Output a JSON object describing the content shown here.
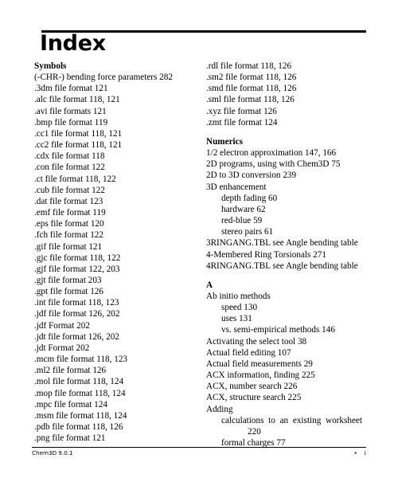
{
  "document": {
    "title": "Index"
  },
  "footer": {
    "left_text": "Chem3D 9.0.1",
    "bullet": "•",
    "page_number": "i"
  },
  "columns": {
    "left": [
      {
        "type": "section",
        "text": "Symbols"
      },
      {
        "type": "entry",
        "text": "(-CHR-) bending force parameters 282"
      },
      {
        "type": "entry",
        "text": ".3dm file format 121"
      },
      {
        "type": "entry",
        "text": ".alc file format 118, 121"
      },
      {
        "type": "entry",
        "text": ".avi file formats 121"
      },
      {
        "type": "entry",
        "text": ".bmp file format 119"
      },
      {
        "type": "entry",
        "text": ".cc1 file format 118, 121"
      },
      {
        "type": "entry",
        "text": ".cc2 file format 118, 121"
      },
      {
        "type": "entry",
        "text": ".cdx file format 118"
      },
      {
        "type": "entry",
        "text": ".con file format 122"
      },
      {
        "type": "entry",
        "text": ".ct file format 118, 122"
      },
      {
        "type": "entry",
        "text": ".cub file format 122"
      },
      {
        "type": "entry",
        "text": ".dat file format 123"
      },
      {
        "type": "entry",
        "text": ".emf file format 119"
      },
      {
        "type": "entry",
        "text": ".eps file format 120"
      },
      {
        "type": "entry",
        "text": ".fch file format 122"
      },
      {
        "type": "entry",
        "text": ".gif file format 121"
      },
      {
        "type": "entry",
        "text": ".gjc file format 118, 122"
      },
      {
        "type": "entry",
        "text": ".gjf file format 122, 203"
      },
      {
        "type": "entry",
        "text": ".gjt file format 203"
      },
      {
        "type": "entry",
        "text": ".gpt file format 126"
      },
      {
        "type": "entry",
        "text": ".int file format 118, 123"
      },
      {
        "type": "entry",
        "text": ".jdf file format 126, 202"
      },
      {
        "type": "entry",
        "text": ".jdf Format 202"
      },
      {
        "type": "entry",
        "text": ".jdt file format 126, 202"
      },
      {
        "type": "entry",
        "text": ".jdt Format 202"
      },
      {
        "type": "entry",
        "text": ".mcm file format 118, 123"
      },
      {
        "type": "entry",
        "text": ".ml2 file format 126"
      },
      {
        "type": "entry",
        "text": ".mol file format 118, 124"
      },
      {
        "type": "entry",
        "text": ".mop file format 118, 124"
      },
      {
        "type": "entry",
        "text": ".mpc file format 124"
      },
      {
        "type": "entry",
        "text": ".msm file format 118, 124"
      },
      {
        "type": "entry",
        "text": ".pdb file format 118, 126"
      },
      {
        "type": "entry",
        "text": ".png file format 121"
      }
    ],
    "right": [
      {
        "type": "entry",
        "text": ".rdl file format 118, 126"
      },
      {
        "type": "entry",
        "text": ".sm2 file format 118, 126"
      },
      {
        "type": "entry",
        "text": ".smd file format 118, 126"
      },
      {
        "type": "entry",
        "text": ".sml file format 118, 126"
      },
      {
        "type": "entry",
        "text": ".xyz file format 126"
      },
      {
        "type": "entry",
        "text": ".zmt file format 124"
      },
      {
        "type": "section",
        "text": "Numerics",
        "spaced": true
      },
      {
        "type": "entry",
        "text": "1/2 electron approximation 147, 166"
      },
      {
        "type": "entry",
        "text": "2D programs, using with Chem3D 75"
      },
      {
        "type": "entry",
        "text": "2D to 3D conversion 239"
      },
      {
        "type": "entry",
        "text": "3D enhancement"
      },
      {
        "type": "sub",
        "text": "depth fading 60"
      },
      {
        "type": "sub",
        "text": "hardware 62"
      },
      {
        "type": "sub",
        "text": "red-blue 59"
      },
      {
        "type": "sub",
        "text": "stereo pairs 61"
      },
      {
        "type": "entry",
        "text": "3RINGANG.TBL see Angle bending table"
      },
      {
        "type": "entry",
        "text": "4-Membered Ring Torsionals 271"
      },
      {
        "type": "entry",
        "text": "4RINGANG.TBL see Angle bending table"
      },
      {
        "type": "section",
        "text": "A",
        "spaced": true
      },
      {
        "type": "entry",
        "text": "Ab initio methods"
      },
      {
        "type": "sub",
        "text": "speed 130"
      },
      {
        "type": "sub",
        "text": "uses 131"
      },
      {
        "type": "sub",
        "text": "vs. semi-empirical methods 146"
      },
      {
        "type": "entry",
        "text": "Activating the select tool 38"
      },
      {
        "type": "entry",
        "text": "Actual field editing 107"
      },
      {
        "type": "entry",
        "text": "Actual field measurements 29"
      },
      {
        "type": "entry",
        "text": "ACX information, finding 225"
      },
      {
        "type": "entry",
        "text": "ACX, number search 226"
      },
      {
        "type": "entry",
        "text": "ACX, structure search 225"
      },
      {
        "type": "entry",
        "text": "Adding"
      },
      {
        "type": "sub-justified",
        "text": "calculations to an existing worksheet"
      },
      {
        "type": "cont-indent",
        "text": "220"
      },
      {
        "type": "sub",
        "text": "formal charges 77"
      }
    ]
  }
}
